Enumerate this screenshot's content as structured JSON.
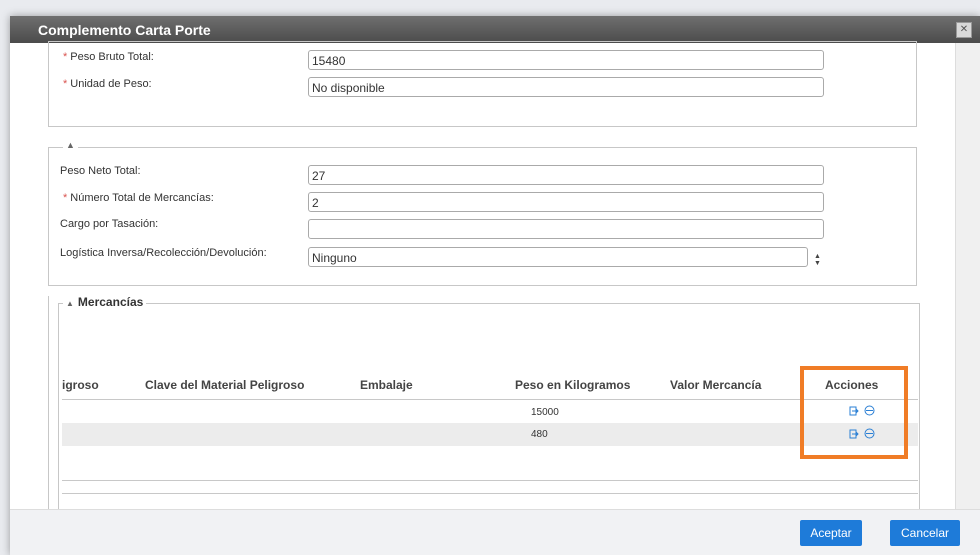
{
  "dialog": {
    "title": "Complemento Carta Porte",
    "close_glyph": "✕"
  },
  "peso_section": {
    "fields": [
      {
        "label": "Peso Bruto Total:",
        "required": true,
        "value": "15480"
      },
      {
        "label": "Unidad de Peso:",
        "required": true,
        "value": "No disponible"
      }
    ]
  },
  "totales_section": {
    "collapse_glyph": "▲",
    "fields": [
      {
        "label": "Peso Neto Total:",
        "required": false,
        "value": "27"
      },
      {
        "label": "Número Total de Mercancías:",
        "required": true,
        "value": "2"
      },
      {
        "label": "Cargo por Tasación:",
        "required": false,
        "value": ""
      },
      {
        "label": "Logística Inversa/Recolección/Devolución:",
        "required": false,
        "value": "Ninguno"
      }
    ],
    "select_arrows": "▲▼"
  },
  "mercancias": {
    "legend": "Mercancías",
    "collapse_glyph": "▲",
    "columns": [
      "igroso",
      "Clave del Material Peligroso",
      "Embalaje",
      "Peso en Kilogramos",
      "Valor Mercancía",
      "Acciones"
    ],
    "rows": [
      {
        "peso": "15000"
      },
      {
        "peso": "480"
      }
    ],
    "icons": {
      "edit": "edit-icon",
      "delete": "delete-icon"
    }
  },
  "footer": {
    "accept_label": "Aceptar",
    "cancel_label": "Cancelar"
  },
  "colors": {
    "highlight": "#f07c26",
    "button": "#1e7bd9",
    "required": "#d9534f",
    "icon": "#2a7fd4"
  }
}
